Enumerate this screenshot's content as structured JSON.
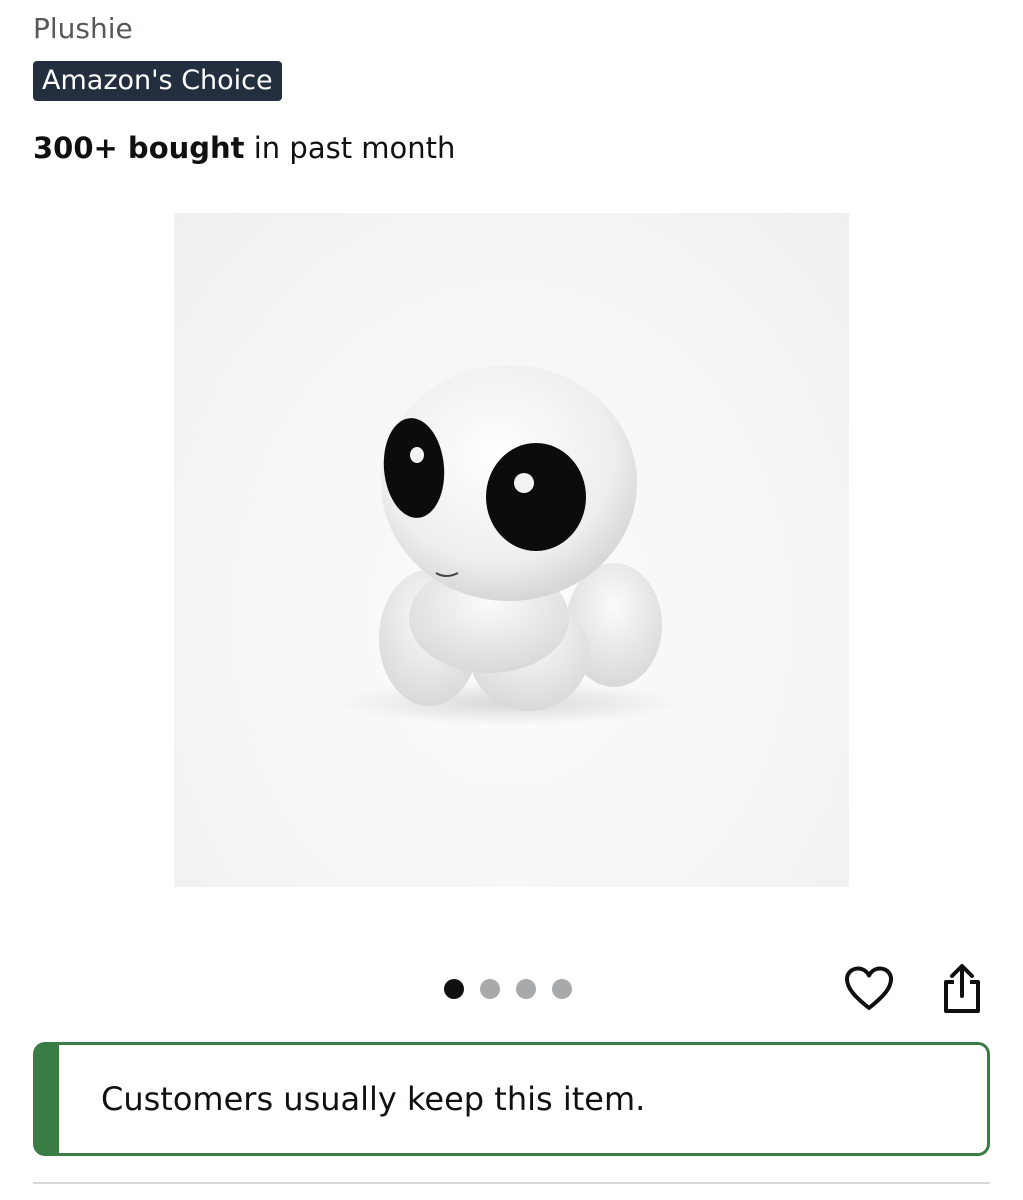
{
  "product": {
    "title_line": "Plushie",
    "badge": "Amazon's Choice",
    "bought_count": "300+ bought",
    "bought_suffix": " in past month"
  },
  "carousel": {
    "image_alt": "White fluffy plush toy with large black eyes",
    "total_images": 4,
    "active_index": 0
  },
  "actions": {
    "wishlist_icon": "heart-icon",
    "share_icon": "share-icon"
  },
  "notice": {
    "text": "Customers usually keep this item.",
    "accent_color": "#3a7d44"
  },
  "colors": {
    "badge_bg": "#232f3e",
    "text_primary": "#0f1111",
    "text_secondary": "#565959",
    "dot_inactive": "#a7a9aa"
  }
}
